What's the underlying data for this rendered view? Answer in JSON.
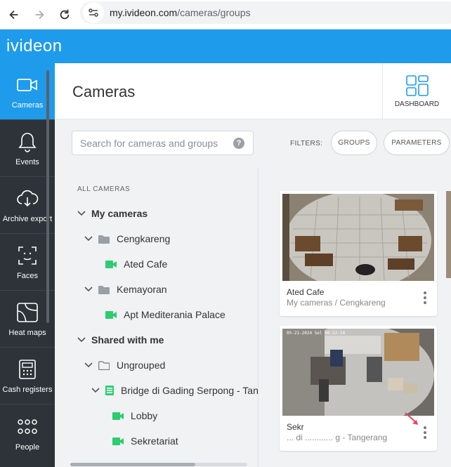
{
  "browser": {
    "url_host": "my.ivideon.com",
    "url_path": "/cameras/groups"
  },
  "app": {
    "logo": "ivideon"
  },
  "sidebar": {
    "items": [
      {
        "label": "Cameras",
        "icon": "camera-icon",
        "active": true
      },
      {
        "label": "Events",
        "icon": "bell-icon"
      },
      {
        "label": "Archive export",
        "icon": "cloud-download-icon"
      },
      {
        "label": "Faces",
        "icon": "face-scan-icon"
      },
      {
        "label": "Heat maps",
        "icon": "heatmap-icon"
      },
      {
        "label": "Cash registers",
        "icon": "cash-register-icon"
      },
      {
        "label": "People",
        "icon": "people-icon"
      }
    ]
  },
  "header": {
    "title": "Cameras",
    "dashboard_label": "DASHBOARD"
  },
  "filters": {
    "search_placeholder": "Search for cameras and groups",
    "help": "?",
    "label": "FILTERS:",
    "chips": [
      "GROUPS",
      "PARAMETERS"
    ]
  },
  "tree": {
    "heading": "ALL CAMERAS",
    "rows": [
      {
        "label": "My cameras",
        "type": "root",
        "expanded": true
      },
      {
        "label": "Cengkareng",
        "type": "folder",
        "expanded": true
      },
      {
        "label": "Ated Cafe",
        "type": "camera"
      },
      {
        "label": "Kemayoran",
        "type": "folder",
        "expanded": true
      },
      {
        "label": "Apt Mediterania Palace",
        "type": "camera"
      },
      {
        "label": "Shared with me",
        "type": "root",
        "expanded": true
      },
      {
        "label": "Ungrouped",
        "type": "folder-outline",
        "expanded": true
      },
      {
        "label": "Bridge di Gading Serpong - Tan",
        "type": "nvr",
        "expanded": true
      },
      {
        "label": "Lobby",
        "type": "camera"
      },
      {
        "label": "Sekretariat",
        "type": "camera"
      }
    ]
  },
  "cards": [
    {
      "title": "Ated Cafe",
      "subtitle": "My cameras / Cengkareng"
    },
    {
      "title": "Sekr",
      "subtitle": "... di ............ g - Tangerang",
      "overlay_timestamp": "05-21-2024 Sel 08:52:14"
    }
  ],
  "colors": {
    "brand": "#1e9bea",
    "sidebar": "#2d3338",
    "camera_green": "#2ecc71"
  }
}
